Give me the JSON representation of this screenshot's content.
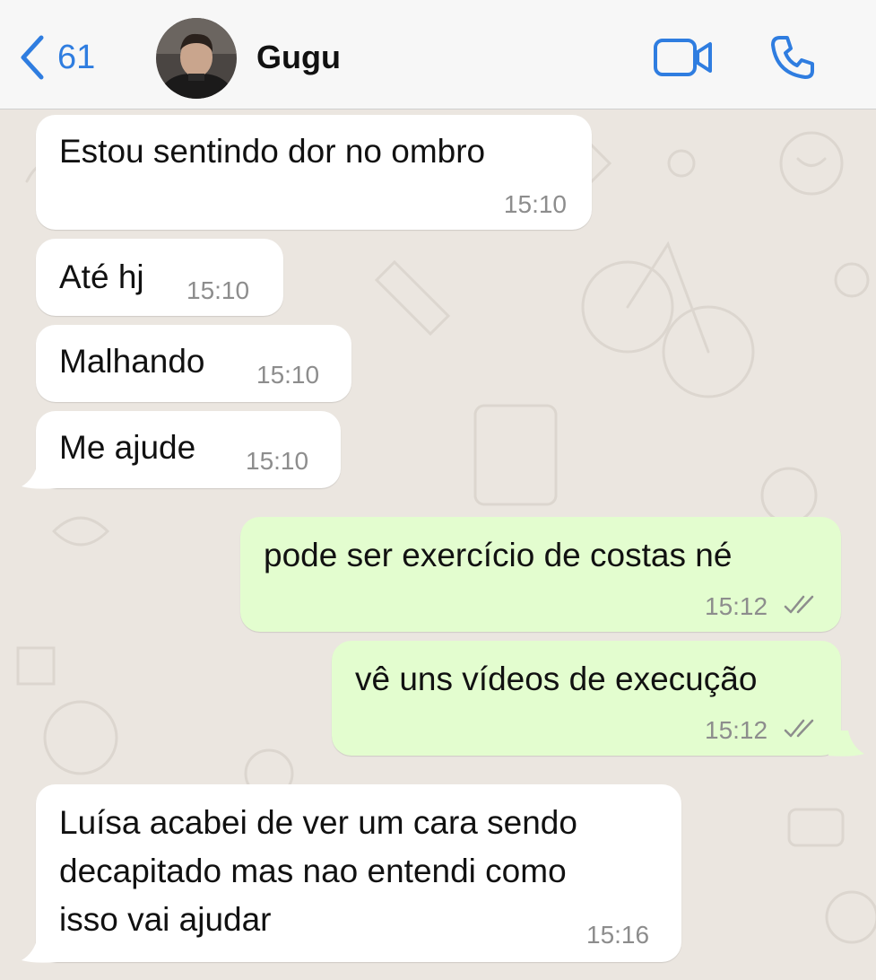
{
  "header": {
    "back_count": "61",
    "contact_name": "Gugu",
    "accent_color": "#2f7de0"
  },
  "messages": [
    {
      "direction": "in",
      "text": "Estou sentindo dor no ombro",
      "time": "15:10"
    },
    {
      "direction": "in",
      "text": "Até hj",
      "time": "15:10"
    },
    {
      "direction": "in",
      "text": "Malhando",
      "time": "15:10"
    },
    {
      "direction": "in",
      "text": "Me ajude",
      "time": "15:10"
    },
    {
      "direction": "out",
      "text": "pode ser exercício de costas né",
      "time": "15:12",
      "status": "read"
    },
    {
      "direction": "out",
      "text": "vê uns vídeos de execução",
      "time": "15:12",
      "status": "read"
    },
    {
      "direction": "in",
      "lines": [
        "Luísa acabei de ver um cara sendo",
        "decapitado mas nao entendi como",
        "isso vai ajudar"
      ],
      "time": "15:16"
    }
  ],
  "icons": {
    "back": "chevron-left-icon",
    "video": "video-camera-icon",
    "call": "phone-icon",
    "read_status": "double-check-icon"
  },
  "colors": {
    "incoming_bubble": "#ffffff",
    "outgoing_bubble": "#e3fdcf",
    "chat_background": "#ebe6e0"
  }
}
